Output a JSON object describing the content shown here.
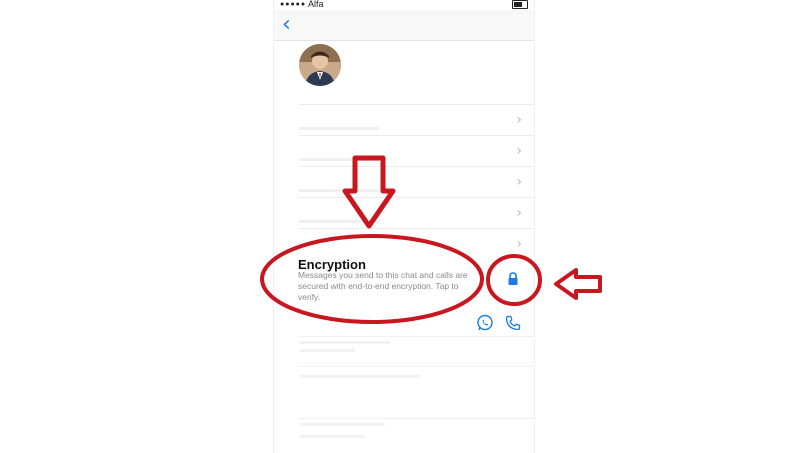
{
  "status_bar": {
    "carrier": "Alfa"
  },
  "nav": {
    "back_icon": "chevron-left-icon"
  },
  "contact": {
    "avatar_icon": "avatar"
  },
  "rows": [
    {
      "chevron": "›"
    },
    {
      "chevron": "›"
    },
    {
      "chevron": "›"
    },
    {
      "chevron": "›"
    },
    {
      "chevron": "›"
    }
  ],
  "encryption": {
    "title": "Encryption",
    "description": "Messages you send to this chat and calls are secured with end-to-end encryption. Tap to verify.",
    "icon": "lock-icon"
  },
  "actions": {
    "whatsapp_icon": "whatsapp-icon",
    "call_icon": "phone-icon"
  },
  "colors": {
    "accent_blue": "#1a7be0",
    "annotation_red": "#c8171e",
    "text_primary": "#111111",
    "text_secondary": "#8a8a8a"
  }
}
